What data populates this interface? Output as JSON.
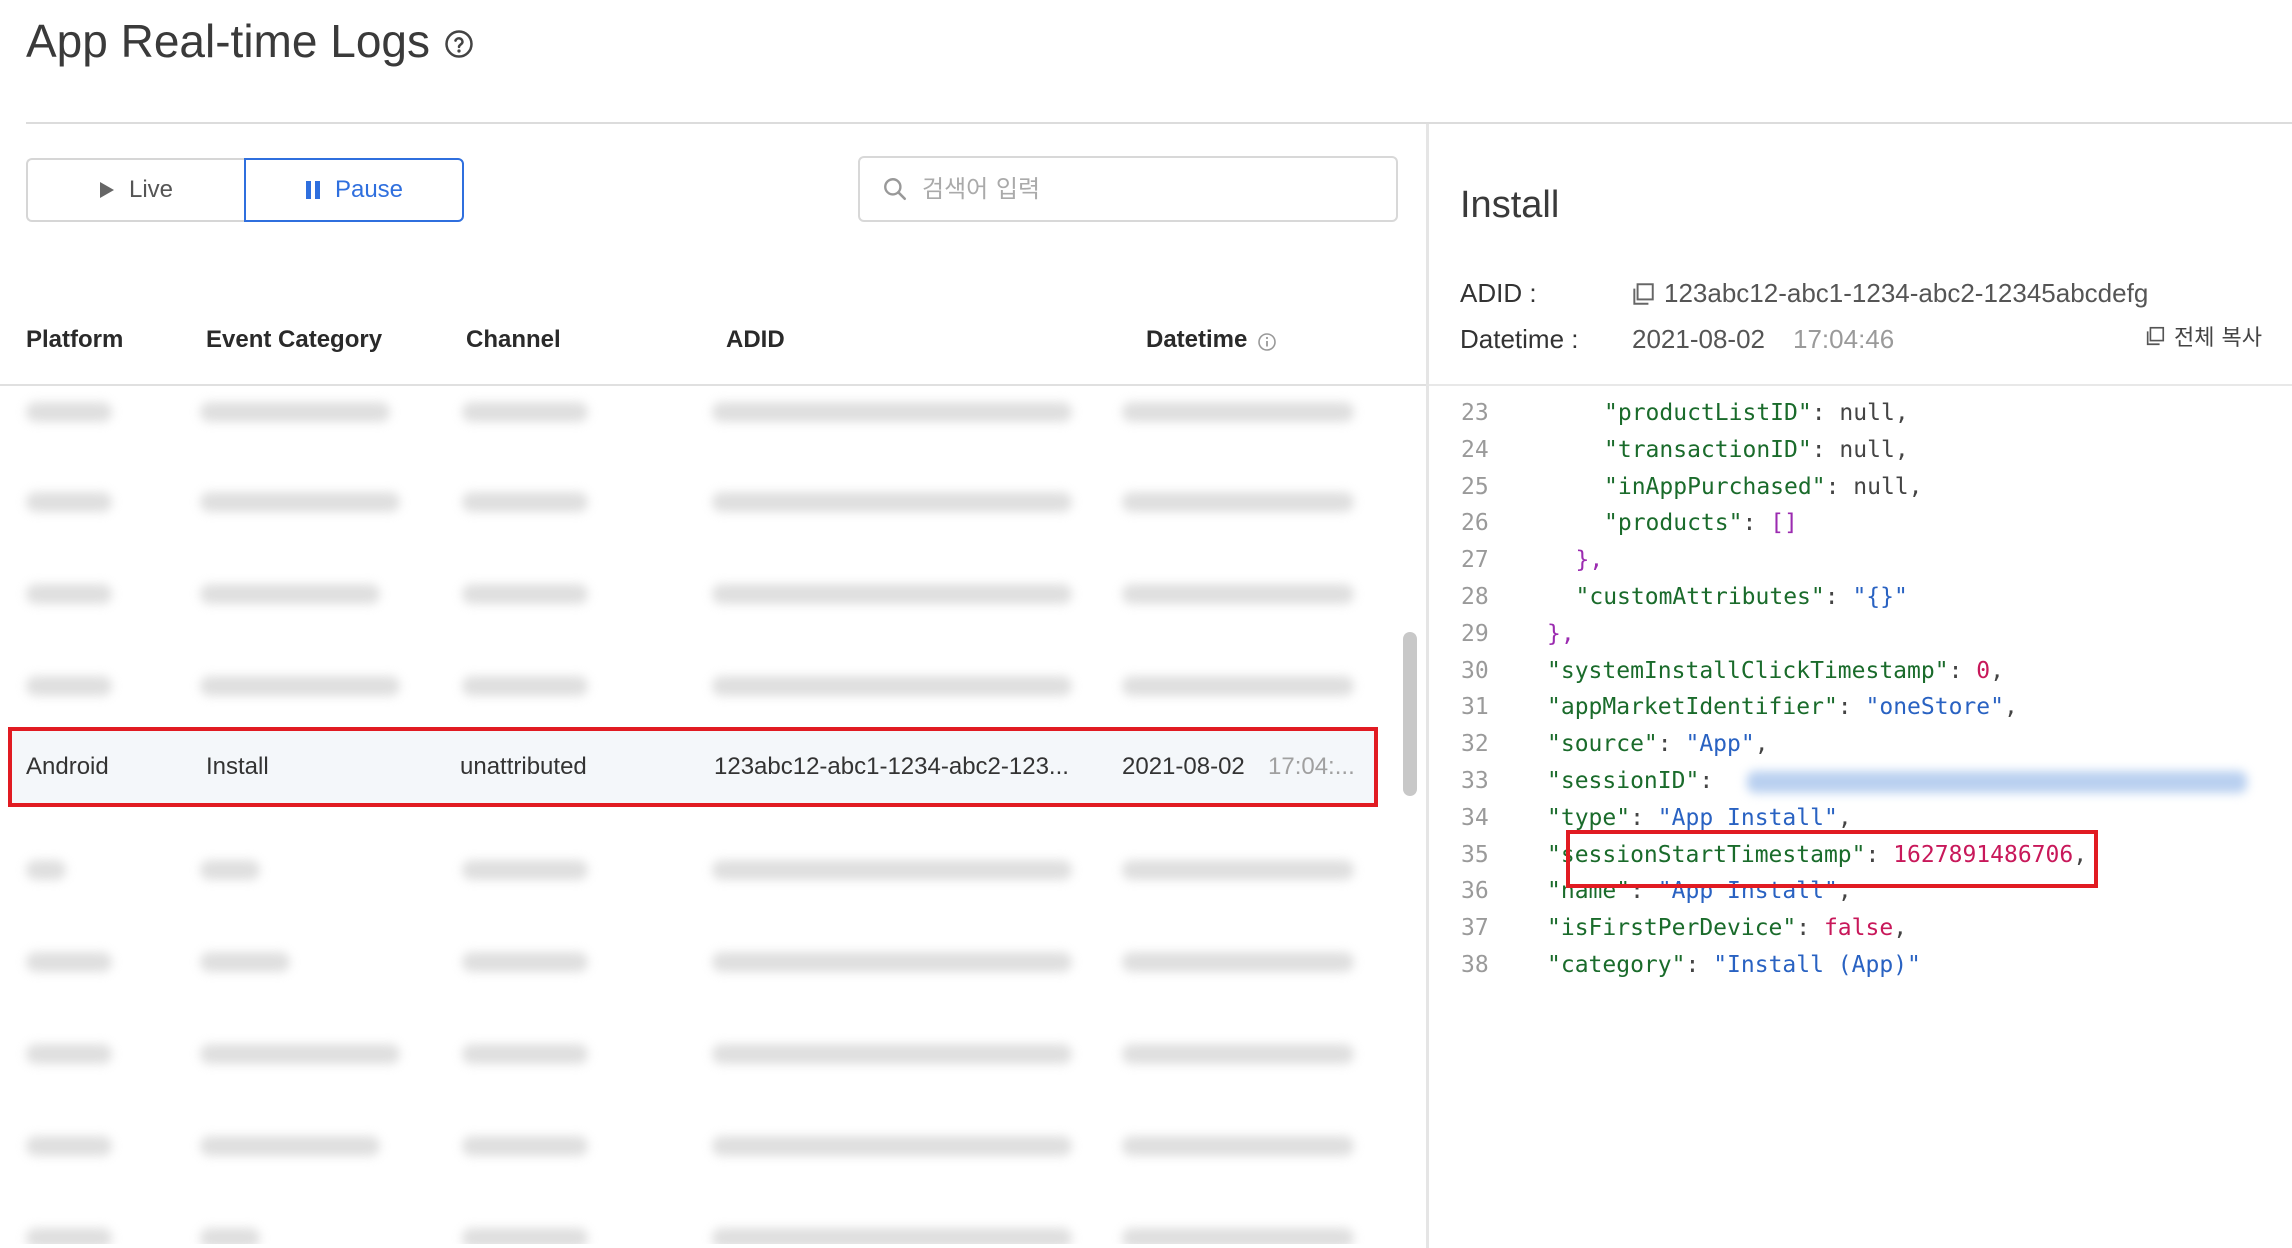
{
  "header": {
    "title": "App Real-time Logs"
  },
  "controls": {
    "live_label": "Live",
    "pause_label": "Pause",
    "search_placeholder": "검색어 입력"
  },
  "table": {
    "columns": [
      "Platform",
      "Event Category",
      "Channel",
      "ADID",
      "Datetime"
    ],
    "selected_row": {
      "platform": "Android",
      "event_category": "Install",
      "channel": "unattributed",
      "adid": "123abc12-abc1-1234-abc2-123...",
      "date": "2021-08-02",
      "time": "17:04:..."
    }
  },
  "detail": {
    "title": "Install",
    "adid_label": "ADID :",
    "adid_value": "123abc12-abc1-1234-abc2-12345abcdefg",
    "datetime_label": "Datetime :",
    "date_value": "2021-08-02",
    "time_value": "17:04:46",
    "copy_all_label": "전체 복사",
    "json_lines": [
      {
        "n": "23",
        "ind": 6,
        "key": "\"productListID\"",
        "val": "null",
        "vt": "p",
        "tail": ","
      },
      {
        "n": "24",
        "ind": 6,
        "key": "\"transactionID\"",
        "val": "null",
        "vt": "p",
        "tail": ","
      },
      {
        "n": "25",
        "ind": 6,
        "key": "\"inAppPurchased\"",
        "val": "null",
        "vt": "p",
        "tail": ","
      },
      {
        "n": "26",
        "ind": 6,
        "key": "\"products\"",
        "val": "[]",
        "vt": "br",
        "tail": ""
      },
      {
        "n": "27",
        "ind": 5,
        "key": "",
        "val": "},",
        "vt": "br",
        "tail": ""
      },
      {
        "n": "28",
        "ind": 5,
        "key": "\"customAttributes\"",
        "val": "\"{}\"",
        "vt": "s",
        "tail": ""
      },
      {
        "n": "29",
        "ind": 4,
        "key": "",
        "val": "},",
        "vt": "br",
        "tail": ""
      },
      {
        "n": "30",
        "ind": 4,
        "key": "\"systemInstallClickTimestamp\"",
        "val": "0",
        "vt": "n",
        "tail": ","
      },
      {
        "n": "31",
        "ind": 4,
        "key": "\"appMarketIdentifier\"",
        "val": "\"oneStore\"",
        "vt": "s",
        "tail": ","
      },
      {
        "n": "32",
        "ind": 4,
        "key": "\"source\"",
        "val": "\"App\"",
        "vt": "s",
        "tail": ","
      },
      {
        "n": "33",
        "ind": 4,
        "key": "\"sessionID\"",
        "val": "",
        "vt": "blur",
        "tail": ""
      },
      {
        "n": "34",
        "ind": 4,
        "key": "\"type\"",
        "val": "\"App Install\"",
        "vt": "s",
        "tail": ","
      },
      {
        "n": "35",
        "ind": 4,
        "key": "\"sessionStartTimestamp\"",
        "val": "1627891486706",
        "vt": "n",
        "tail": ","
      },
      {
        "n": "36",
        "ind": 4,
        "key": "\"name\"",
        "val": "\"App Install\"",
        "vt": "s",
        "tail": ","
      },
      {
        "n": "37",
        "ind": 4,
        "key": "\"isFirstPerDevice\"",
        "val": "false",
        "vt": "n",
        "tail": ","
      },
      {
        "n": "38",
        "ind": 4,
        "key": "\"category\"",
        "val": "\"Install (App)\"",
        "vt": "s",
        "tail": ""
      }
    ]
  }
}
